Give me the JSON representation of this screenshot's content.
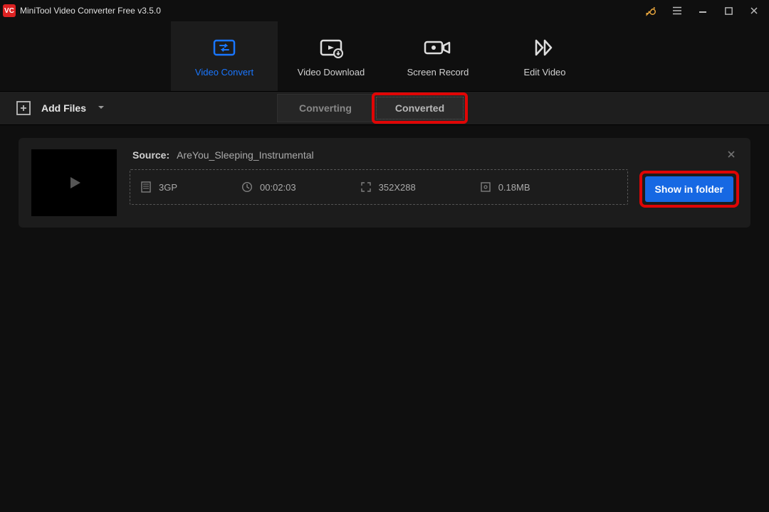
{
  "app": {
    "title": "MiniTool Video Converter Free v3.5.0"
  },
  "main_tabs": [
    {
      "label": "Video Convert",
      "active": true
    },
    {
      "label": "Video Download",
      "active": false
    },
    {
      "label": "Screen Record",
      "active": false
    },
    {
      "label": "Edit Video",
      "active": false
    }
  ],
  "toolbar": {
    "add_files_label": "Add Files"
  },
  "sub_tabs": {
    "converting_label": "Converting",
    "converted_label": "Converted"
  },
  "item": {
    "source_label": "Source:",
    "source_name": "AreYou_Sleeping_Instrumental",
    "format": "3GP",
    "duration": "00:02:03",
    "resolution": "352X288",
    "size": "0.18MB",
    "show_in_folder_label": "Show in folder"
  },
  "colors": {
    "accent_blue": "#1976ff",
    "button_blue": "#1668e3",
    "highlight_red": "#e00505"
  }
}
